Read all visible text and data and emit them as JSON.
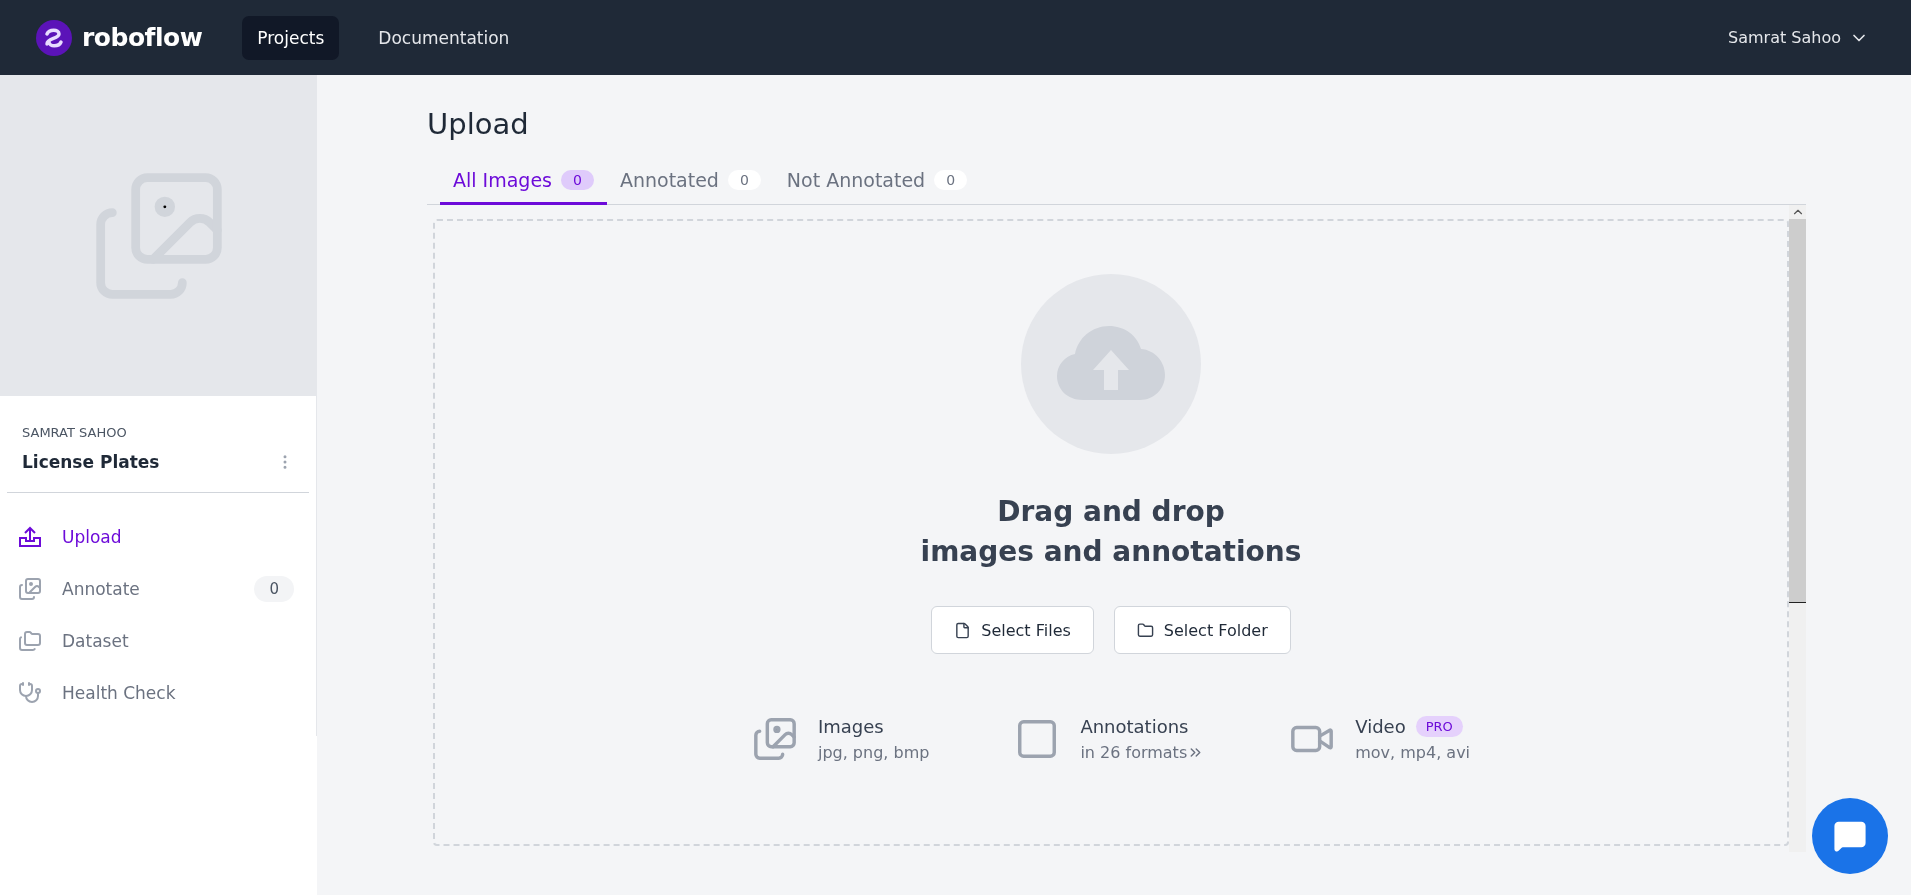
{
  "topbar": {
    "brand": "roboflow",
    "nav": [
      {
        "label": "Projects",
        "selected": true
      },
      {
        "label": "Documentation",
        "selected": false
      }
    ],
    "user": "Samrat Sahoo"
  },
  "sidebar": {
    "owner": "SAMRAT SAHOO",
    "project": "License Plates",
    "items": [
      {
        "label": "Upload",
        "kind": "upload",
        "selected": true
      },
      {
        "label": "Annotate",
        "kind": "images",
        "selected": false,
        "count": "0"
      },
      {
        "label": "Dataset",
        "kind": "folders",
        "selected": false
      },
      {
        "label": "Health Check",
        "kind": "stethoscope",
        "selected": false
      }
    ]
  },
  "main": {
    "title": "Upload",
    "tabs": [
      {
        "label": "All Images",
        "count": "0",
        "selected": true
      },
      {
        "label": "Annotated",
        "count": "0",
        "selected": false
      },
      {
        "label": "Not Annotated",
        "count": "0",
        "selected": false
      }
    ],
    "dropzone": {
      "headline": [
        "Drag and drop",
        "images and annotations"
      ],
      "buttons": [
        {
          "label": "Select Files",
          "kind": "file"
        },
        {
          "label": "Select Folder",
          "kind": "folder"
        }
      ],
      "formats": [
        {
          "kind": "images",
          "title": "Images",
          "detail": "jpg, png, bmp"
        },
        {
          "kind": "annotations",
          "title": "Annotations",
          "detail": "in 26 formats"
        },
        {
          "kind": "video",
          "title": "Video",
          "badge": "PRO",
          "detail": "mov, mp4, avi"
        }
      ]
    }
  }
}
